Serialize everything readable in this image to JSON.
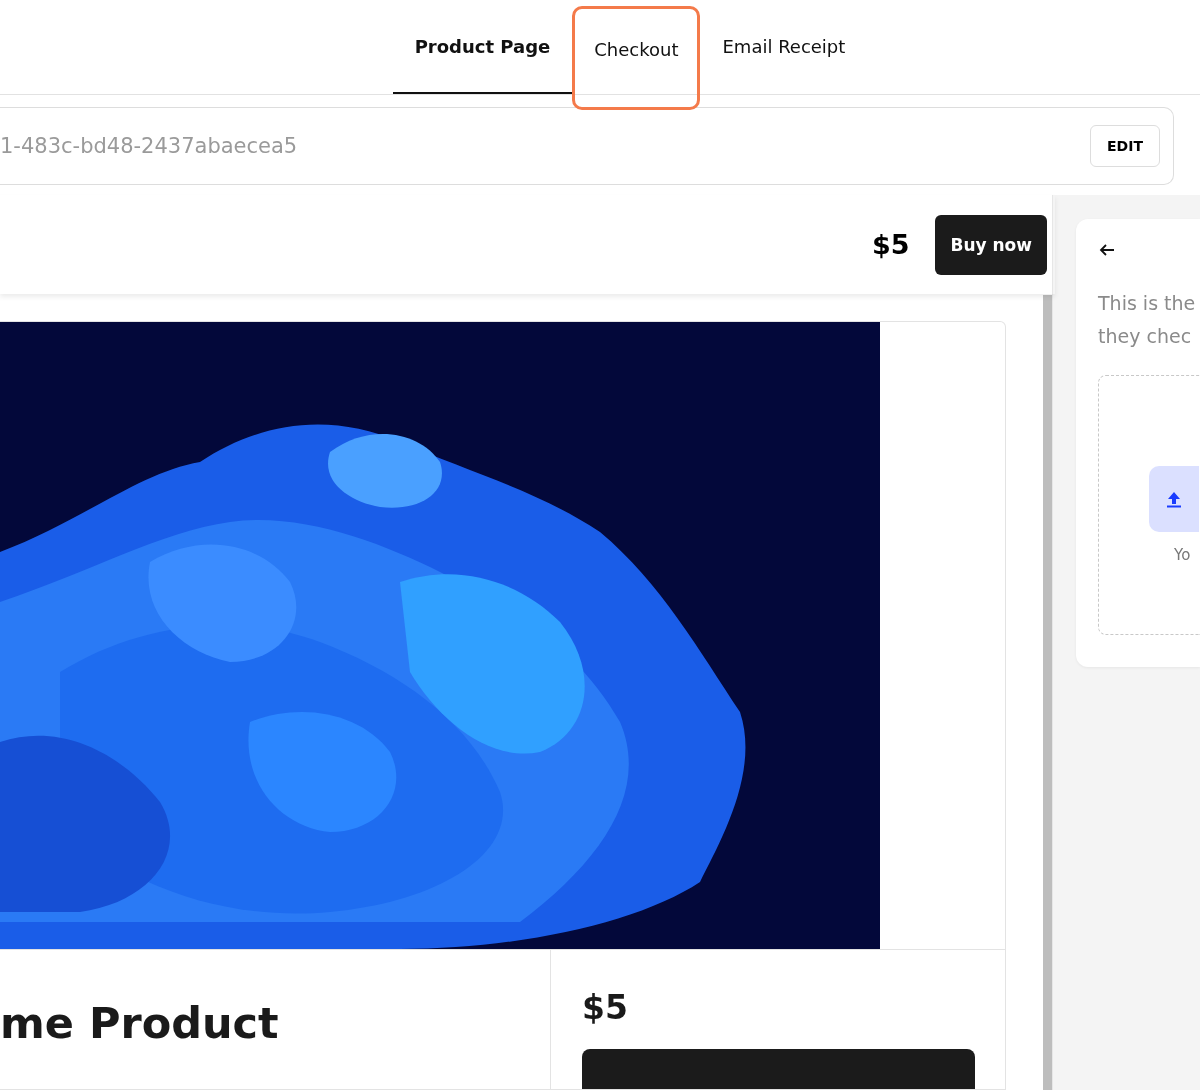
{
  "tabs": [
    {
      "label": "Product Page",
      "selected": true,
      "highlighted": false
    },
    {
      "label": "Checkout",
      "selected": false,
      "highlighted": true
    },
    {
      "label": "Email Receipt",
      "selected": false,
      "highlighted": false
    }
  ],
  "url_bar": {
    "value": "1-483c-bd48-2437abaecea5",
    "button": "EDIT"
  },
  "product_preview": {
    "header": {
      "price": "$5",
      "button": "Buy now"
    },
    "title": "me Product",
    "price": "$5"
  },
  "checkout_panel": {
    "text_lines": [
      "This is the",
      "they chec"
    ],
    "upload_caption": "Yo"
  }
}
